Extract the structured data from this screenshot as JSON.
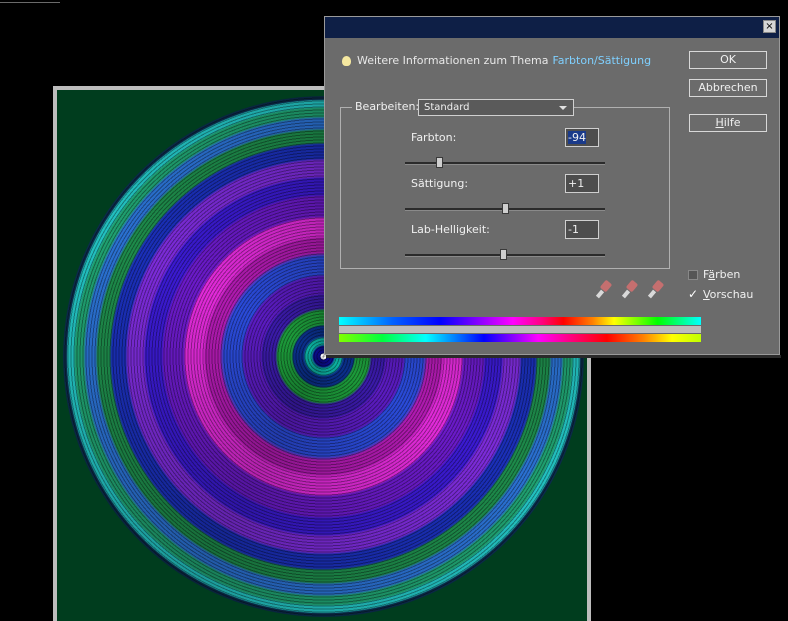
{
  "dialog": {
    "info_text": "Weitere Informationen zum Thema",
    "info_link": "Farbton/Sättigung",
    "close_glyph": "×",
    "buttons": {
      "ok": "OK",
      "cancel": "Abbrechen",
      "help_first": "H",
      "help_rest": "ilfe"
    },
    "edit_label": "Bearbeiten:",
    "edit_value": "Standard",
    "sliders": [
      {
        "label": "Farbton:",
        "value": "-94",
        "fraction": 0.17
      },
      {
        "label": "Sättigung:",
        "value": "+1",
        "fraction": 0.5
      },
      {
        "label": "Lab-Helligkeit:",
        "value": "-1",
        "fraction": 0.49
      }
    ],
    "checkboxes": {
      "colorize": {
        "pre": "F",
        "acc": "ä",
        "post": "rben",
        "checked": false
      },
      "preview": {
        "pre": "",
        "acc": "V",
        "post": "orschau",
        "checked": true
      }
    },
    "eyedropper_icons": [
      "eyedropper-icon",
      "eyedropper-plus-icon",
      "eyedropper-minus-icon"
    ]
  }
}
